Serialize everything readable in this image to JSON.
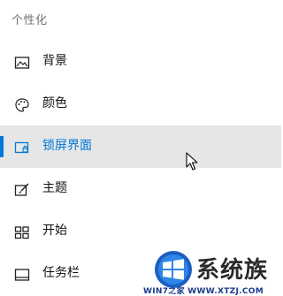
{
  "section_header": "个性化",
  "accent_color": "#0078d7",
  "nav": {
    "items": [
      {
        "label": "背景",
        "icon": "picture-icon",
        "selected": false
      },
      {
        "label": "颜色",
        "icon": "palette-icon",
        "selected": false
      },
      {
        "label": "锁屏界面",
        "icon": "lock-screen-icon",
        "selected": true
      },
      {
        "label": "主题",
        "icon": "theme-brush-icon",
        "selected": false
      },
      {
        "label": "开始",
        "icon": "start-tiles-icon",
        "selected": false
      },
      {
        "label": "任务栏",
        "icon": "taskbar-icon",
        "selected": false
      }
    ]
  },
  "watermark": {
    "brand": "系统族",
    "url": "WIN7之家 WWW.XTZJ.COM"
  }
}
